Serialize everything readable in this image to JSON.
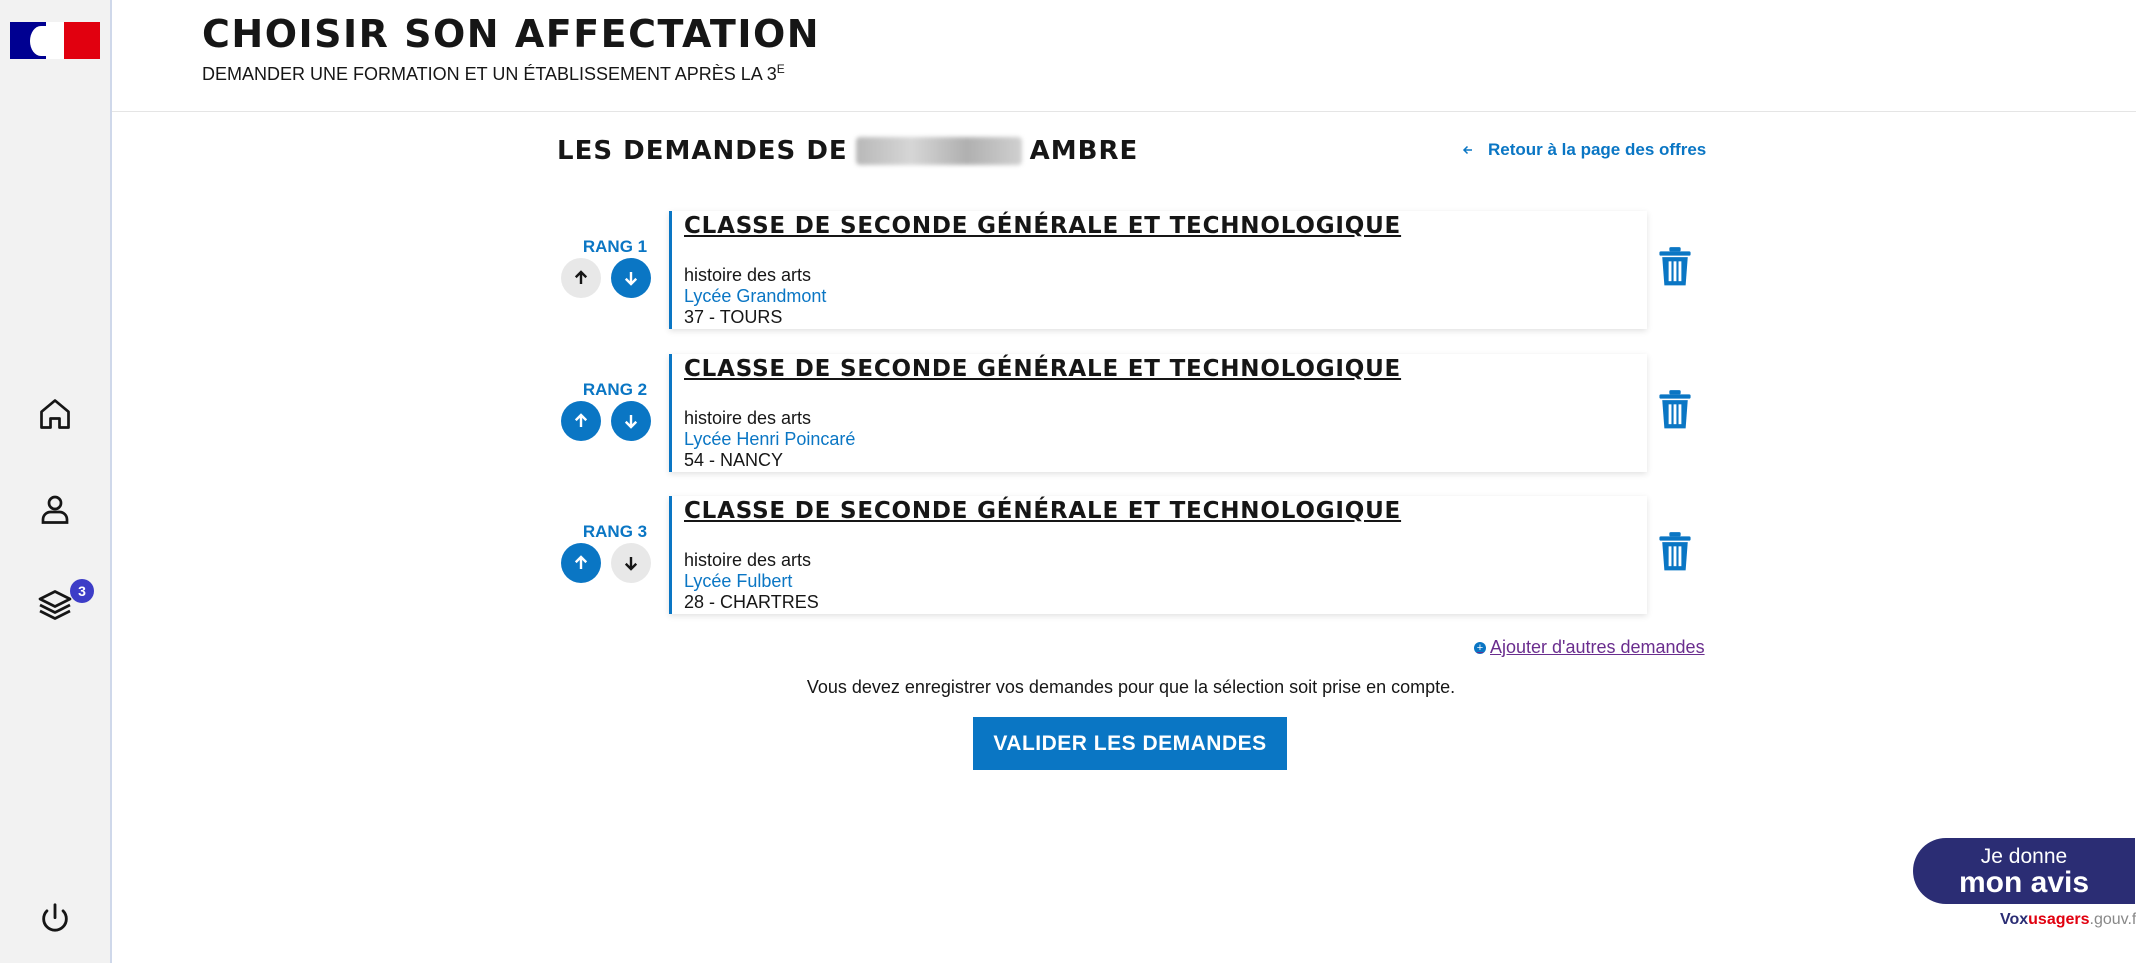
{
  "header": {
    "title": "CHOISIR SON AFFECTATION",
    "subtitle": "DEMANDER UNE FORMATION ET UN ÉTABLISSEMENT APRÈS LA 3",
    "subtitle_sup": "E"
  },
  "sidebar": {
    "items": [
      {
        "icon": "home-icon"
      },
      {
        "icon": "user-icon"
      },
      {
        "icon": "layers-icon",
        "badge": "3"
      },
      {
        "icon": "power-icon"
      }
    ]
  },
  "main": {
    "heading_prefix": "LES DEMANDES DE",
    "heading_suffix": "AMBRE",
    "back_link": "Retour à la page des offres",
    "requests": [
      {
        "rank": "RANG 1",
        "title": "CLASSE DE SECONDE GÉNÉRALE ET TECHNOLOGIQUE",
        "option": "histoire des arts",
        "school": "Lycée Grandmont",
        "city": "37 - TOURS",
        "up_enabled": false,
        "down_enabled": true
      },
      {
        "rank": "RANG 2",
        "title": "CLASSE DE SECONDE GÉNÉRALE ET TECHNOLOGIQUE",
        "option": "histoire des arts",
        "school": "Lycée Henri Poincaré",
        "city": "54 - NANCY",
        "up_enabled": true,
        "down_enabled": true
      },
      {
        "rank": "RANG 3",
        "title": "CLASSE DE SECONDE GÉNÉRALE ET TECHNOLOGIQUE",
        "option": "histoire des arts",
        "school": "Lycée Fulbert",
        "city": "28 - CHARTRES",
        "up_enabled": true,
        "down_enabled": false
      }
    ],
    "add_link": "Ajouter d'autres demandes",
    "notice": "Vous devez enregistrer vos demandes pour que la sélection soit prise en compte.",
    "submit_label": "VALIDER LES DEMANDES"
  },
  "vox": {
    "line1": "Je donne",
    "line2": "mon avis",
    "brand_1": "Vox",
    "brand_2": "usagers",
    "brand_3": ".gouv.fr"
  },
  "colors": {
    "accent": "#0a76c4",
    "badge": "#3d3dc7",
    "vox": "#2b2d74"
  }
}
